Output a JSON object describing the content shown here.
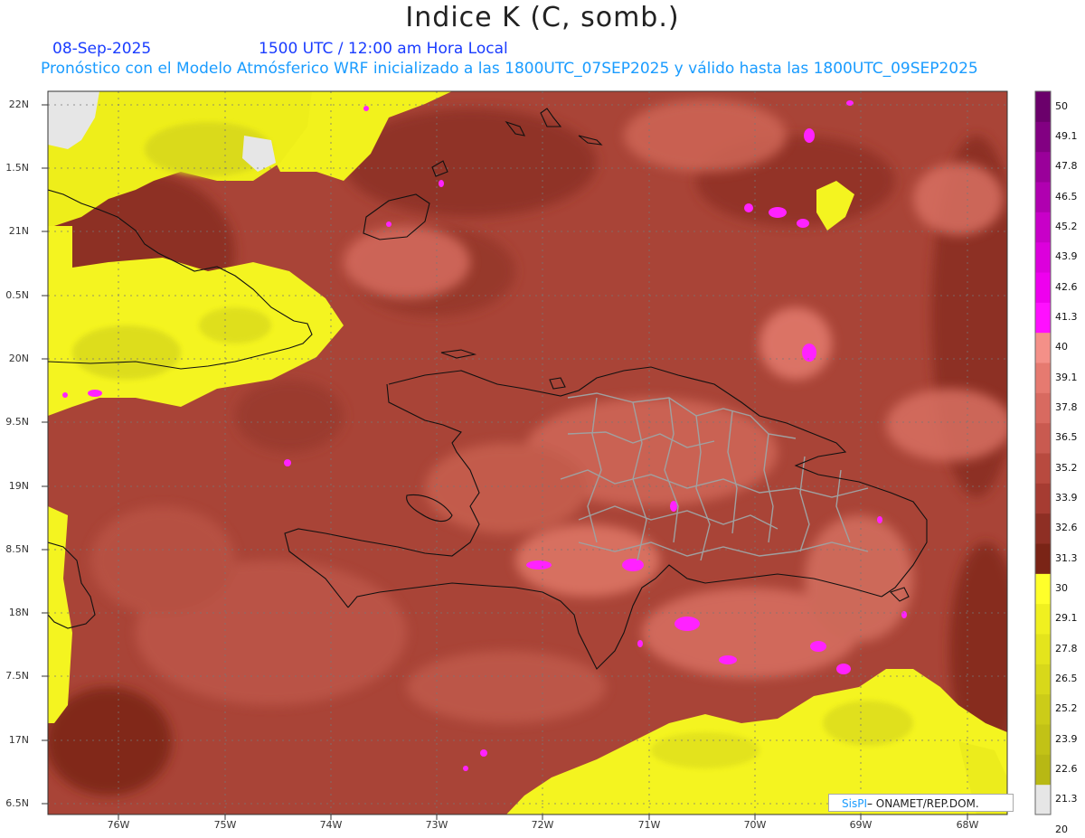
{
  "header": {
    "title": "Indice K (C, somb.)",
    "date": "08-Sep-2025",
    "time": "1500 UTC / 12:00 am Hora Local",
    "subtitle": "Pronóstico con el Modelo Atmósferico WRF inicializado a las 1800UTC_07SEP2025 y válido hasta las  1800UTC_09SEP2025"
  },
  "axes": {
    "lat_labels": [
      "22N",
      "1.5N",
      "21N",
      "0.5N",
      "20N",
      "9.5N",
      "19N",
      "8.5N",
      "18N",
      "7.5N",
      "17N",
      "6.5N"
    ],
    "lon_labels": [
      "76W",
      "75W",
      "74W",
      "73W",
      "72W",
      "71W",
      "70W",
      "69W",
      "68W"
    ]
  },
  "colorbar": {
    "labels": [
      "50",
      "49.1",
      "47.8",
      "46.5",
      "45.2",
      "43.9",
      "42.6",
      "41.3",
      "40",
      "39.1",
      "37.8",
      "36.5",
      "35.2",
      "33.9",
      "32.6",
      "31.3",
      "30",
      "29.1",
      "27.8",
      "26.5",
      "25.2",
      "23.9",
      "22.6",
      "21.3",
      "20"
    ],
    "colors": [
      "#6b006b",
      "#820082",
      "#9a009a",
      "#b000b0",
      "#c800c8",
      "#dc00dc",
      "#ee00ee",
      "#ff10ff",
      "#f49088",
      "#e67a70",
      "#d86a60",
      "#c95a50",
      "#b84a3f",
      "#a63c32",
      "#8e2f24",
      "#7a2416",
      "#ffff2a",
      "#f0f020",
      "#e4e41c",
      "#d8d81a",
      "#cccc18",
      "#c2c216",
      "#b8b814",
      "#e6e6e6"
    ]
  },
  "credit": {
    "brand": "SisPI",
    "org": " ONAMET/REP.DOM."
  },
  "colors": {
    "base_field": "#b04a3c",
    "dry_field": "#f6f61e",
    "land_mask": "#e6e6e6",
    "grid": "#7a7a7a",
    "border": "#9a9a9a"
  }
}
